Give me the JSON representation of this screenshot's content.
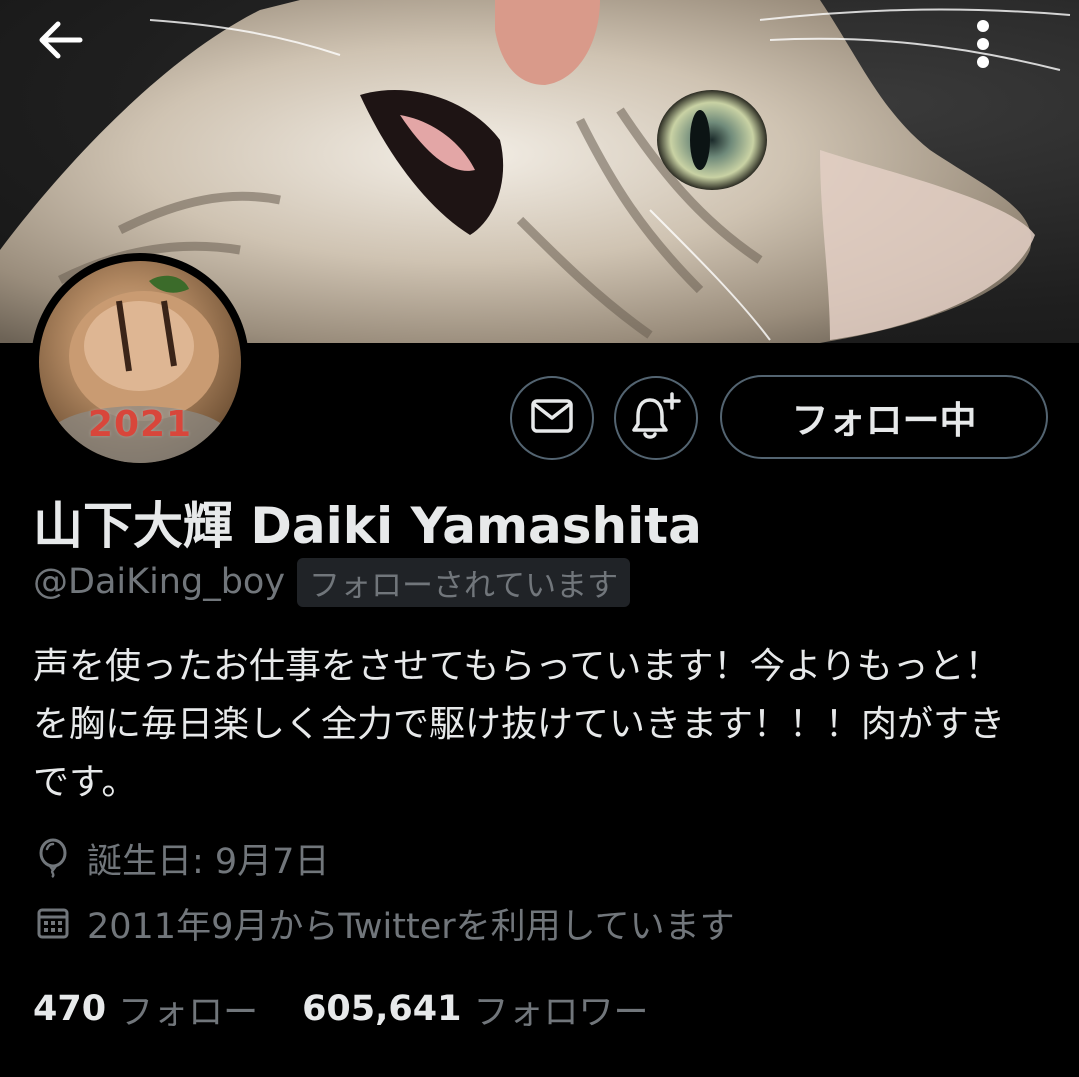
{
  "header": {
    "back_icon": "arrow-left-icon",
    "more_icon": "more-vertical-icon"
  },
  "avatar": {
    "overlay_text": "2021"
  },
  "actions": {
    "message_icon": "envelope-icon",
    "notify_icon": "bell-plus-icon",
    "follow_label": "フォロー中"
  },
  "profile": {
    "display_name": "山下大輝 Daiki Yamashita",
    "handle": "@DaiKing_boy",
    "follows_you": "フォローされています",
    "bio": "声を使ったお仕事をさせてもらっています！今よりもっと！を胸に毎日楽しく全力で駆け抜けていきます！！！肉がすきです。",
    "birthday": "誕生日: 9月7日",
    "joined": "2011年9月からTwitterを利用しています"
  },
  "stats": {
    "following_count": "470",
    "following_label": "フォロー",
    "followers_count": "605,641",
    "followers_label": "フォロワー"
  },
  "colors": {
    "background": "#000000",
    "primary_text": "#e7e9ea",
    "secondary_text": "#71767b",
    "border": "#536471",
    "avatar_text": "#d8463b"
  }
}
